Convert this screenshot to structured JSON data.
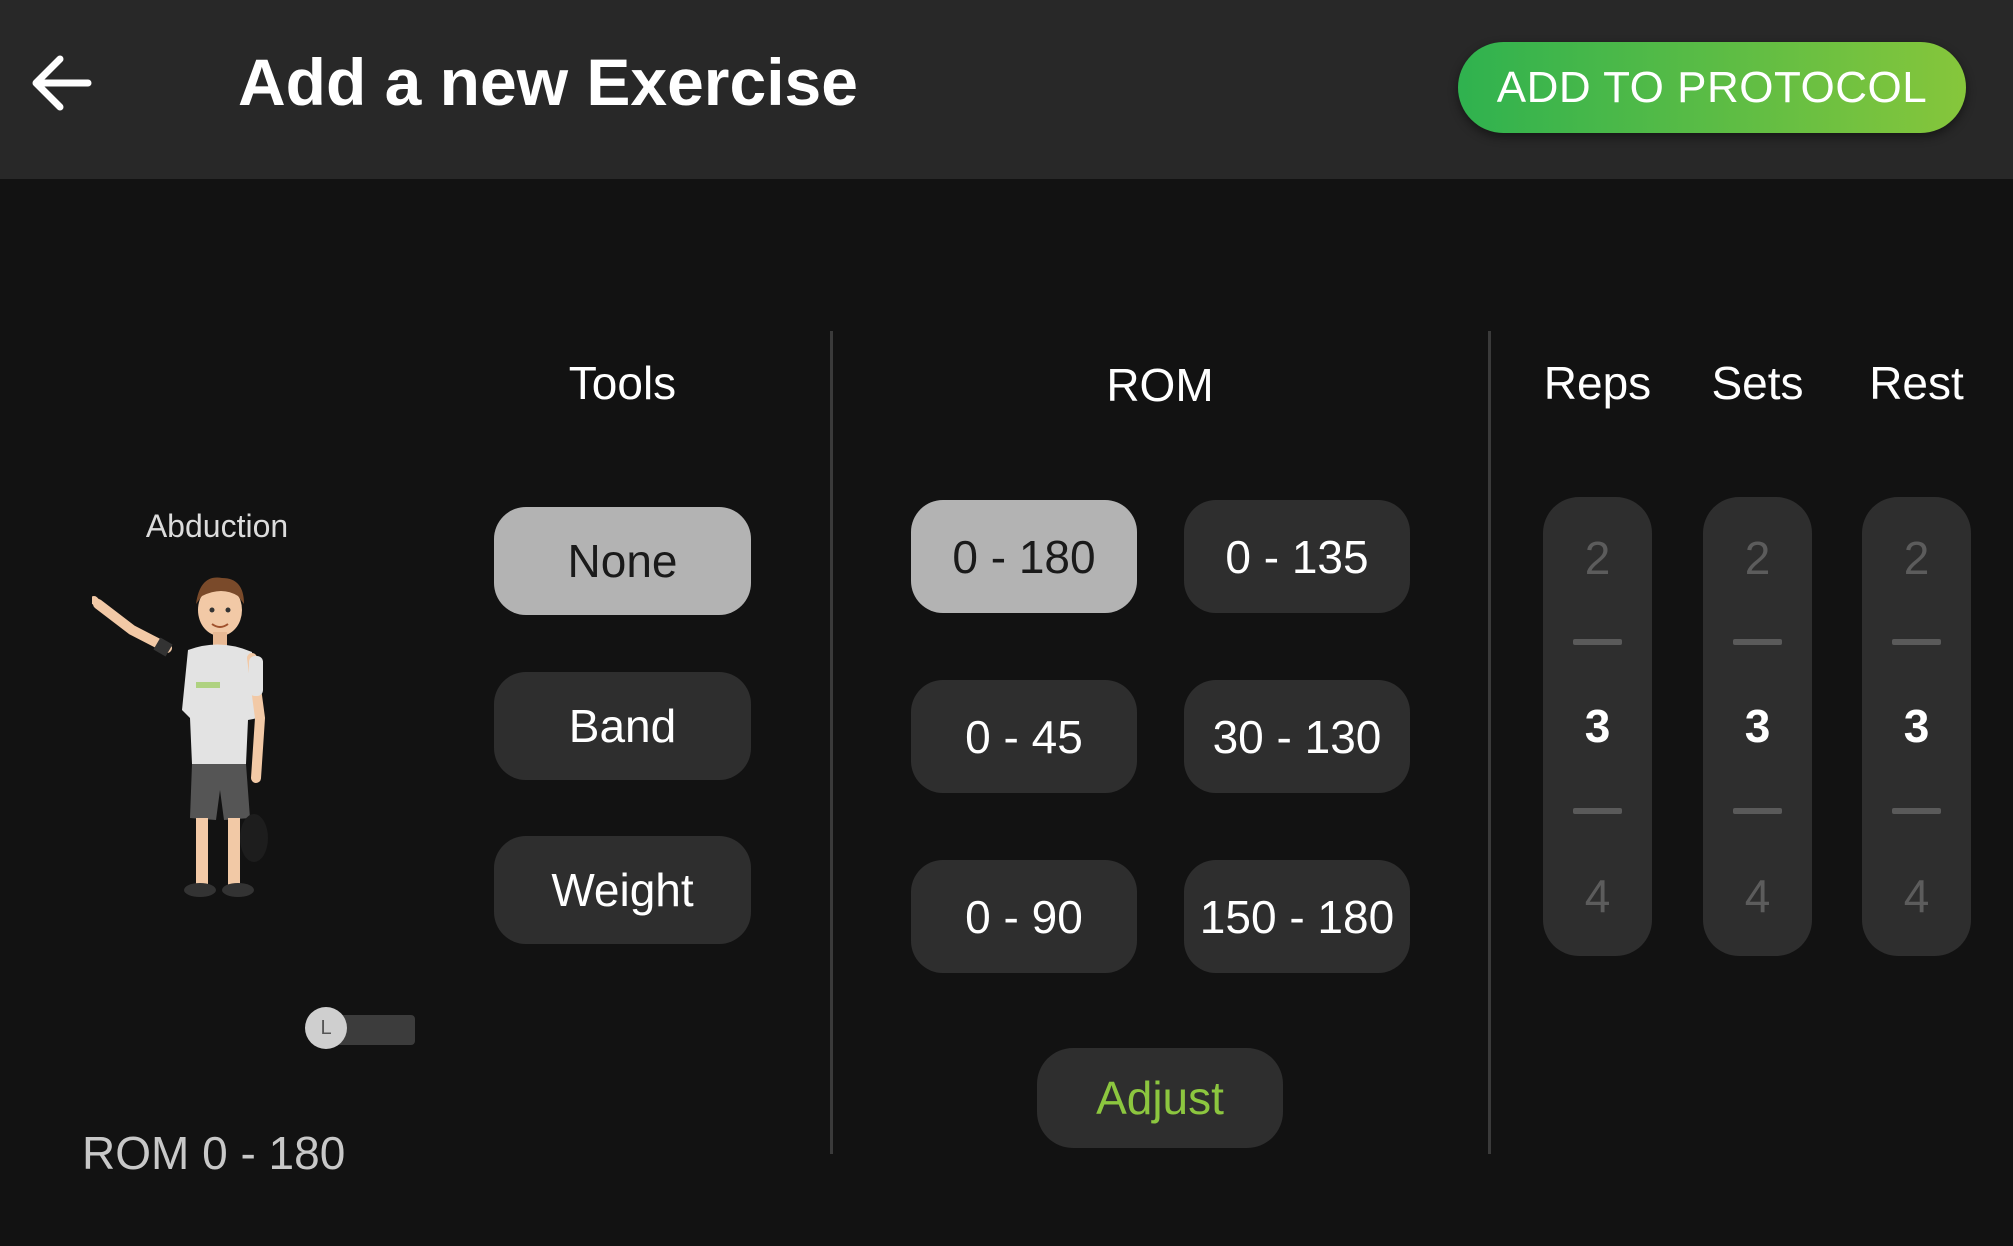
{
  "header": {
    "title": "Add a new Exercise",
    "add_button_label": "ADD TO PROTOCOL",
    "back_icon": "arrow-left-icon"
  },
  "exercise": {
    "name": "Abduction",
    "side_toggle_label": "L",
    "rom_readout": "ROM 0 - 180"
  },
  "tools": {
    "heading": "Tools",
    "options": [
      "None",
      "Band",
      "Weight"
    ],
    "selected": "None"
  },
  "rom": {
    "heading": "ROM",
    "options": [
      "0 - 180",
      "0 - 135",
      "0 - 45",
      "30 - 130",
      "0 - 90",
      "150 - 180"
    ],
    "selected": "0 - 180",
    "adjust_label": "Adjust"
  },
  "pickers": [
    {
      "heading": "Reps",
      "prev": "2",
      "current": "3",
      "next": "4"
    },
    {
      "heading": "Sets",
      "prev": "2",
      "current": "3",
      "next": "4"
    },
    {
      "heading": "Rest",
      "prev": "2",
      "current": "3",
      "next": "4"
    }
  ],
  "colors": {
    "header_bg": "#282828",
    "page_bg": "#121212",
    "accent_green": "#8cc63f",
    "button_gradient_start": "#2fb24f",
    "button_gradient_end": "#86c63b",
    "selected_pill": "#b3b3b3",
    "pill_bg": "#2e2e2e"
  }
}
